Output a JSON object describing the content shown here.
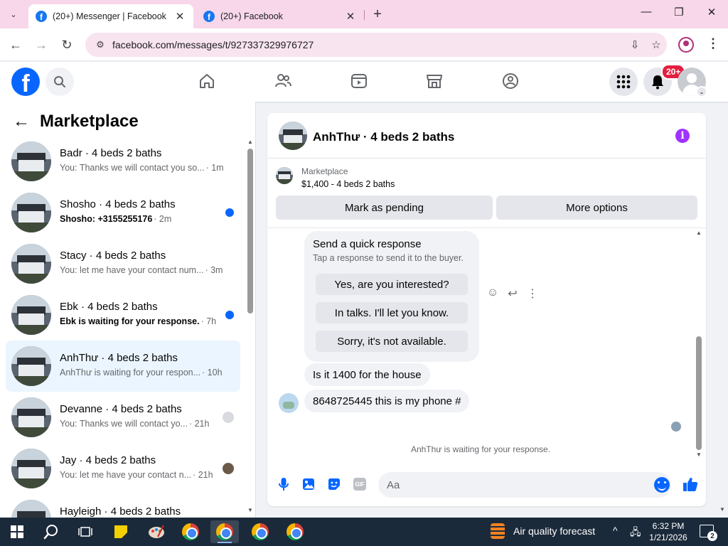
{
  "browser": {
    "tabs": [
      {
        "title": "(20+) Messenger | Facebook",
        "active": true
      },
      {
        "title": "(20+) Facebook",
        "active": false
      }
    ],
    "url": "facebook.com/messages/t/927337329976727",
    "icons": {
      "tab_menu": "chevron-down-icon",
      "new_tab": "plus-icon",
      "back": "back-arrow-icon",
      "forward": "forward-arrow-icon",
      "reload": "reload-icon",
      "install": "install-app-icon",
      "bookmark": "star-icon",
      "profile": "profile-icon",
      "menu": "kebab-menu-icon"
    },
    "glyphs": {
      "chevron": "⌄",
      "close": "✕",
      "plus": "+",
      "back": "←",
      "forward": "→",
      "reload": "↻",
      "site_info": "⚙",
      "install": "⇩",
      "star": "☆",
      "kebab": "⋮",
      "minimize": "—",
      "maximize": "❐",
      "win_close": "✕"
    }
  },
  "facebook": {
    "logo_letter": "f",
    "notifications_badge": "20+",
    "colors": {
      "brand": "#0866ff",
      "badge": "#e41e3f",
      "info": "#a033ff",
      "selected_row": "#ebf5ff"
    }
  },
  "sidebar": {
    "back_glyph": "←",
    "title": "Marketplace",
    "conversations": [
      {
        "name": "Badr · 4 beds 2 baths",
        "preview": "You: Thanks we will contact you so...",
        "time": "· 1m",
        "status": "none"
      },
      {
        "name": "Shosho · 4 beds 2 baths",
        "preview": "Shosho: +3155255176",
        "time": "· 2m",
        "status": "unread"
      },
      {
        "name": "Stacy · 4 beds 2 baths",
        "preview": "You: let me have your contact num...",
        "time": "· 3m",
        "status": "none"
      },
      {
        "name": "Ebk · 4 beds 2 baths",
        "preview": "Ebk is waiting for your response.",
        "time": "· 7h",
        "status": "unread"
      },
      {
        "name": "AnhThư · 4 beds 2 baths",
        "preview": "AnhThư is waiting for your respon...",
        "time": "· 10h",
        "status": "selected"
      },
      {
        "name": "Devanne · 4 beds 2 baths",
        "preview": "You: Thanks we will contact yo...",
        "time": "· 21h",
        "status": "seen"
      },
      {
        "name": "Jay · 4 beds 2 baths",
        "preview": "You: let me have your contact n...",
        "time": "· 21h",
        "status": "seen-photo"
      },
      {
        "name": "Hayleigh · 4 beds 2 baths",
        "preview": "",
        "time": "",
        "status": "none"
      }
    ]
  },
  "chat": {
    "title": "AnhThư · 4 beds 2 baths",
    "info_glyph": "i",
    "listing": {
      "source": "Marketplace",
      "detail": "$1,400 - 4 beds 2 baths",
      "mark_pending": "Mark as pending",
      "more_options": "More options"
    },
    "quick_response": {
      "title": "Send a quick response",
      "subtitle": "Tap a response to send it to the buyer.",
      "options": [
        "Yes, are you interested?",
        "In talks. I'll let you know.",
        "Sorry, it's not available."
      ]
    },
    "message_tools": {
      "react": "☺",
      "reply": "↩",
      "more": "⋮"
    },
    "messages": [
      "Is it 1400 for the house",
      "8648725445 this is my phone #"
    ],
    "waiting_note": "AnhThư is waiting for your response.",
    "composer": {
      "placeholder": "Aa",
      "gif": "GIF"
    }
  },
  "taskbar": {
    "weather": "Air quality forecast",
    "time": "6:32 PM",
    "date": "1/21/2026",
    "notification_count": "2",
    "tray": {
      "chevron": "^",
      "network": "🖧"
    }
  }
}
